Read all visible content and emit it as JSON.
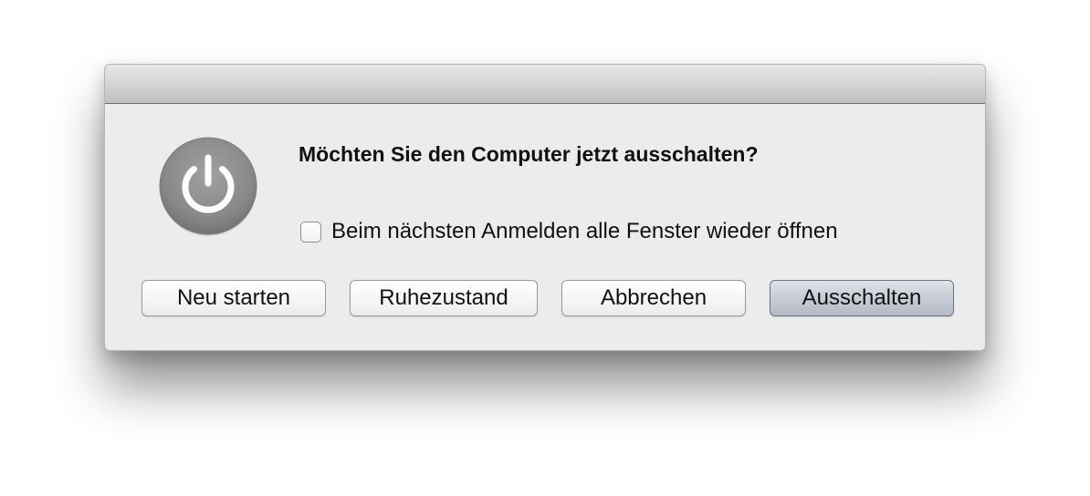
{
  "dialog": {
    "message": "Möchten Sie den Computer jetzt ausschalten?",
    "checkbox": {
      "label": "Beim nächsten Anmelden alle Fenster wieder öffnen",
      "checked": false
    },
    "icon": "power-icon",
    "buttons": {
      "restart": "Neu starten",
      "sleep": "Ruhezustand",
      "cancel": "Abbrechen",
      "shutdown": "Ausschalten"
    },
    "default_button": "shutdown"
  },
  "colors": {
    "dialog_background": "#ececec",
    "icon_gray": "#8a8a8a",
    "default_button": "#c7ccd5"
  }
}
